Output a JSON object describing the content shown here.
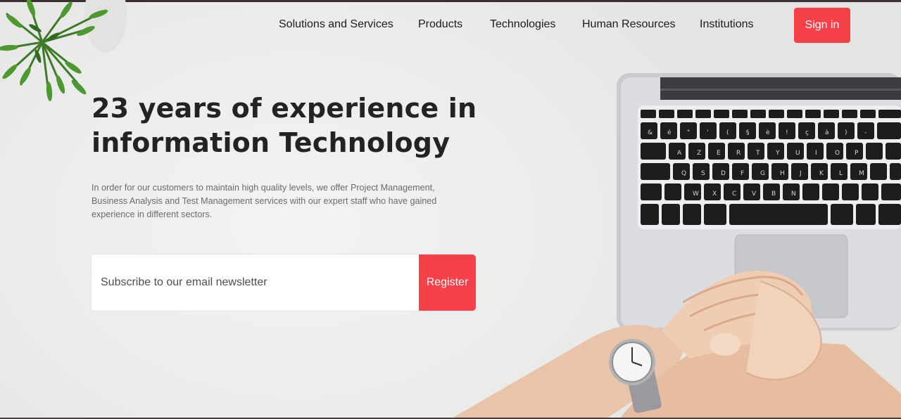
{
  "nav": {
    "items": [
      {
        "label": "Solutions and Services"
      },
      {
        "label": "Products"
      },
      {
        "label": "Technologies"
      },
      {
        "label": "Human Resources"
      },
      {
        "label": "Institutions"
      }
    ],
    "signin_label": "Sign in"
  },
  "hero": {
    "title_line1": "23 years of experience in",
    "title_line2": "information Technology",
    "description": "In order for our customers to maintain high quality levels, we offer Project Management, Business Analysis and Test Management services with our expert staff who have gained experience in different sectors."
  },
  "subscribe": {
    "placeholder": "Subscribe to our email newsletter",
    "button_label": "Register"
  },
  "colors": {
    "accent": "#f64148",
    "text_dark": "#232323",
    "text_muted": "#6b6b6b"
  },
  "icons": {
    "plant": "plant-decoration-icon",
    "laptop": "laptop-illustration",
    "hands": "hands-with-watch-illustration"
  }
}
